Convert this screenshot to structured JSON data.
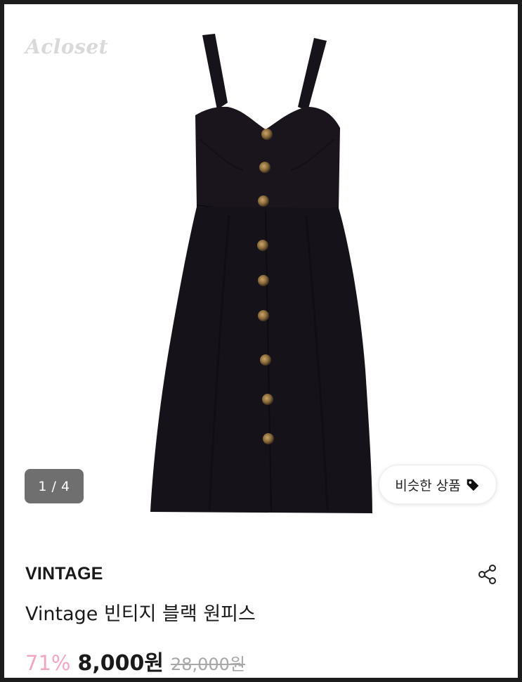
{
  "image": {
    "watermark": "Acloset",
    "pager": "1 / 4",
    "similar_button_label": "비슷한 상품",
    "similar_button_icon": "tag-icon"
  },
  "product": {
    "brand": "VINTAGE",
    "title": "Vintage 빈티지 블랙 원피스",
    "discount": "71%",
    "price": "8,000원",
    "original_price": "28,000원",
    "share_icon": "share-icon"
  },
  "colors": {
    "discount": "#f3a6c4",
    "dress": "#15121a",
    "button_tortoise": "#a2814c"
  }
}
